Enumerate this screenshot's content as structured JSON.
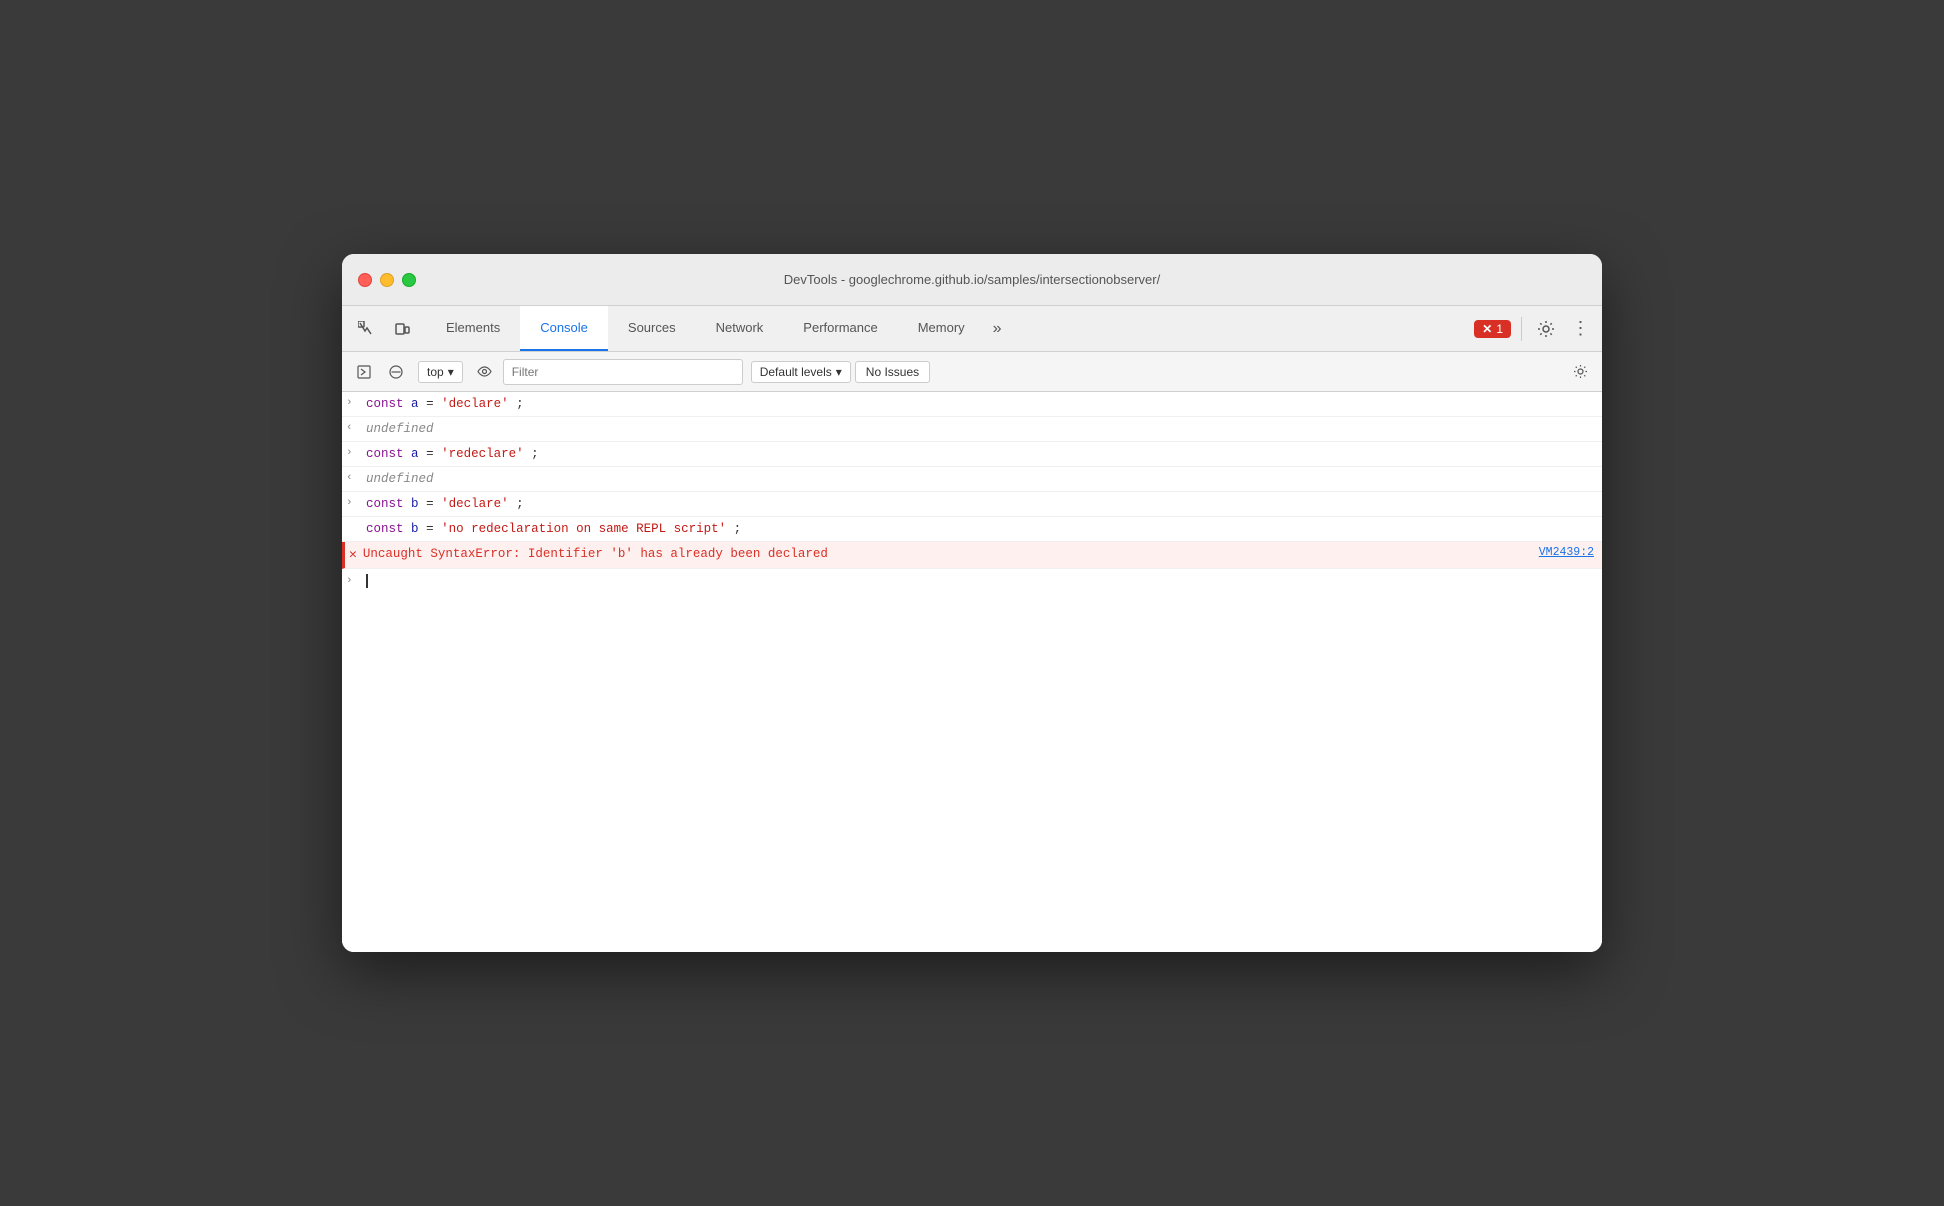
{
  "window": {
    "title": "DevTools - googlechrome.github.io/samples/intersectionobserver/"
  },
  "tabs": {
    "items": [
      {
        "id": "elements",
        "label": "Elements"
      },
      {
        "id": "console",
        "label": "Console"
      },
      {
        "id": "sources",
        "label": "Sources"
      },
      {
        "id": "network",
        "label": "Network"
      },
      {
        "id": "performance",
        "label": "Performance"
      },
      {
        "id": "memory",
        "label": "Memory"
      }
    ],
    "active": "console",
    "more_label": "»"
  },
  "header": {
    "inspect_icon": "⬚",
    "device_icon": "⬜",
    "error_count": "1",
    "settings_icon": "⚙",
    "more_icon": "⋮"
  },
  "console_toolbar": {
    "run_icon": "▶",
    "clear_icon": "🚫",
    "context_label": "top",
    "context_arrow": "▾",
    "eye_icon": "👁",
    "filter_placeholder": "Filter",
    "levels_label": "Default levels",
    "levels_arrow": "▾",
    "no_issues_label": "No Issues",
    "settings_icon": "⚙"
  },
  "console_output": {
    "lines": [
      {
        "type": "input",
        "arrow": ">",
        "content": [
          {
            "type": "keyword",
            "text": "const"
          },
          {
            "type": "space",
            "text": " "
          },
          {
            "type": "variable",
            "text": "a"
          },
          {
            "type": "operator",
            "text": " = "
          },
          {
            "type": "string",
            "text": "'declare'"
          },
          {
            "type": "operator",
            "text": ";"
          }
        ]
      },
      {
        "type": "return",
        "arrow": "←",
        "content": [
          {
            "type": "undefined",
            "text": "undefined"
          }
        ]
      },
      {
        "type": "input",
        "arrow": ">",
        "content": [
          {
            "type": "keyword",
            "text": "const"
          },
          {
            "type": "space",
            "text": " "
          },
          {
            "type": "variable",
            "text": "a"
          },
          {
            "type": "operator",
            "text": " = "
          },
          {
            "type": "string",
            "text": "'redeclare'"
          },
          {
            "type": "operator",
            "text": ";"
          }
        ]
      },
      {
        "type": "return",
        "arrow": "←",
        "content": [
          {
            "type": "undefined",
            "text": "undefined"
          }
        ]
      },
      {
        "type": "input",
        "arrow": ">",
        "content": [
          {
            "type": "keyword",
            "text": "const"
          },
          {
            "type": "space",
            "text": " "
          },
          {
            "type": "variable",
            "text": "b"
          },
          {
            "type": "operator",
            "text": " = "
          },
          {
            "type": "string",
            "text": "'declare'"
          },
          {
            "type": "operator",
            "text": ";"
          }
        ]
      },
      {
        "type": "input-continuation",
        "content": [
          {
            "type": "keyword",
            "text": "const"
          },
          {
            "type": "space",
            "text": " "
          },
          {
            "type": "variable",
            "text": "b"
          },
          {
            "type": "operator",
            "text": " = "
          },
          {
            "type": "string",
            "text": "'no redeclaration on same REPL script'"
          },
          {
            "type": "operator",
            "text": ";"
          }
        ]
      },
      {
        "type": "error",
        "arrow": "✕",
        "error_text": "Uncaught SyntaxError: Identifier 'b' has already been declared",
        "source": "VM2439:2"
      }
    ],
    "input_arrow": ">"
  }
}
